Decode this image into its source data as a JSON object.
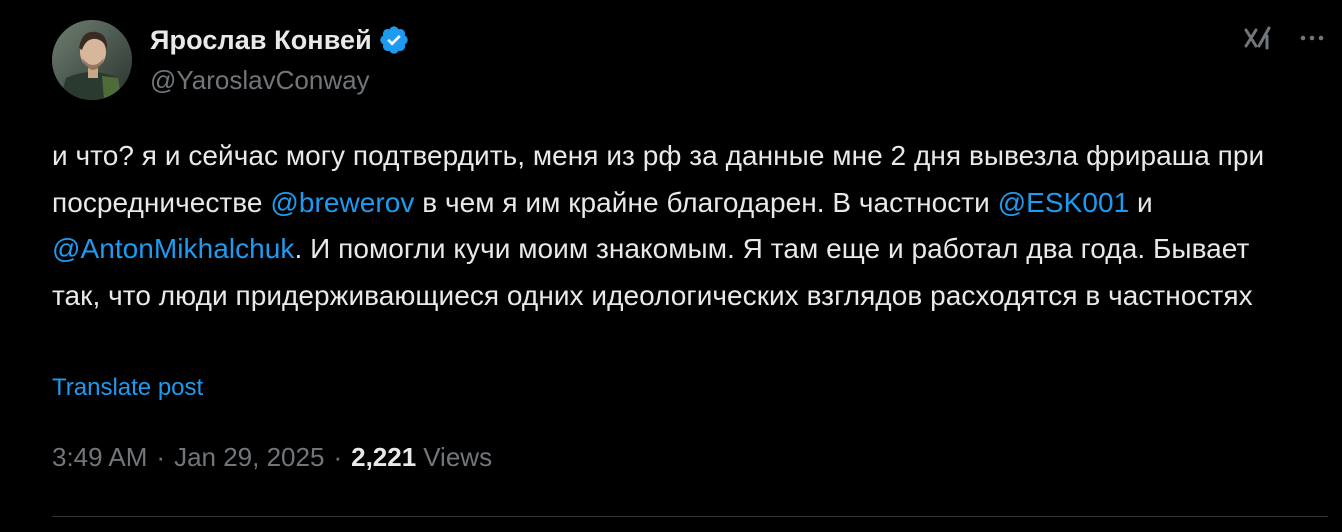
{
  "author": {
    "display_name": "Ярослав Конвей",
    "handle": "@YaroslavConway",
    "verified": true,
    "verified_color": "#1d9bf0"
  },
  "icons": {
    "avatar": "avatar-photo",
    "verified": "verified-badge-icon",
    "grok": "grok-icon",
    "more": "more-options-icon"
  },
  "tweet": {
    "segments": [
      {
        "type": "text",
        "value": "и что? я и сейчас могу подтвердить, меня из рф за данные мне 2 дня вывезла фрираша при посредничестве "
      },
      {
        "type": "mention",
        "value": "@brewerov"
      },
      {
        "type": "text",
        "value": " в чем я им крайне благодарен. В частности "
      },
      {
        "type": "mention",
        "value": "@ESK001"
      },
      {
        "type": "text",
        "value": " и "
      },
      {
        "type": "mention",
        "value": "@AntonMikhalchuk"
      },
      {
        "type": "text",
        "value": ". И помогли кучи моим знакомым. Я там еще и работал два года. Бывает так, что люди придерживающиеся одних идеологических взглядов расходятся в частностях"
      }
    ],
    "translate_label": "Translate post"
  },
  "meta": {
    "time": "3:49 AM",
    "separator": "·",
    "date": "Jan 29, 2025",
    "views_count": "2,221",
    "views_label": "Views"
  },
  "colors": {
    "background": "#000000",
    "text": "#e7e9ea",
    "secondary": "#71767b",
    "link": "#1d9bf0",
    "divider": "#2f3336"
  }
}
